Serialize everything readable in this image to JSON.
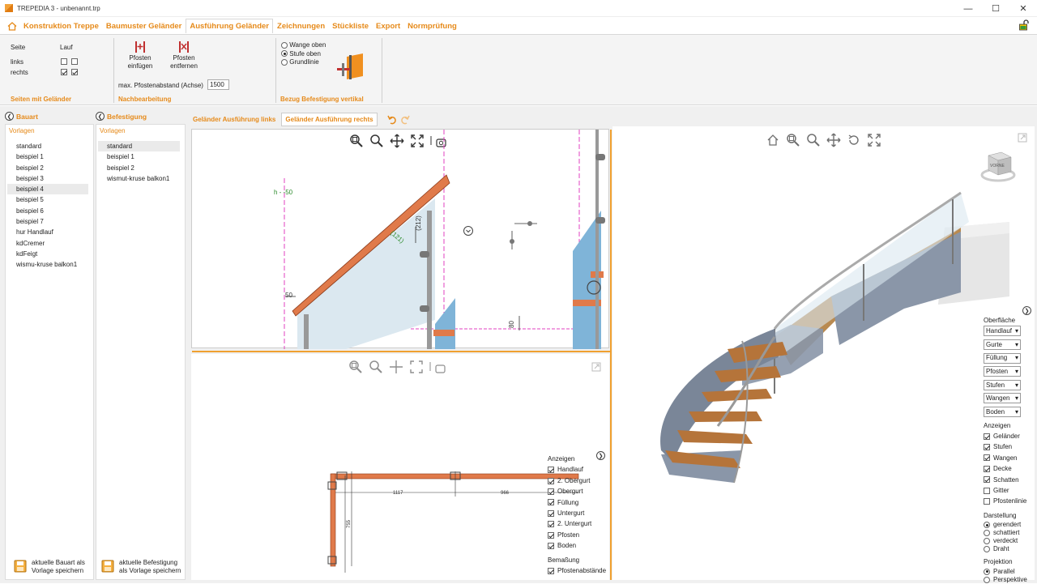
{
  "window": {
    "title": "TREPEDIA 3 - unbenannt.trp"
  },
  "menu": {
    "items": [
      {
        "label": "Konstruktion Treppe"
      },
      {
        "label": "Baumuster Geländer"
      },
      {
        "label": "Ausführung Geländer"
      },
      {
        "label": "Zeichnungen"
      },
      {
        "label": "Stückliste"
      },
      {
        "label": "Export"
      },
      {
        "label": "Normprüfung"
      }
    ],
    "active_index": 2
  },
  "ribbon": {
    "seiten": {
      "col_seite": "Seite",
      "col_lauf": "Lauf",
      "row_links": "links",
      "row_rechts": "rechts",
      "links_checked": [
        false,
        false
      ],
      "rechts_checked": [
        true,
        true
      ],
      "title": "Seiten mit Geländer"
    },
    "nachbearbeitung": {
      "pfosten_einfuegen_1": "Pfosten",
      "pfosten_einfuegen_2": "einfügen",
      "pfosten_entfernen_1": "Pfosten",
      "pfosten_entfernen_2": "entfernen",
      "abstand_label": "max. Pfostenabstand (Achse)",
      "abstand_value": "1500",
      "title": "Nachbearbeitung"
    },
    "bezug": {
      "options": [
        "Wange oben",
        "Stufe oben",
        "Grundlinie"
      ],
      "selected": 1,
      "title": "Bezug Befestigung vertikal"
    }
  },
  "bauart": {
    "header": "Bauart",
    "vorlagen": "Vorlagen",
    "items": [
      "standard",
      "beispiel 1",
      "beispiel 2",
      "beispiel 3",
      "beispiel 4",
      "beispiel 5",
      "beispiel 6",
      "beispiel 7",
      "hur Handlauf",
      "kdCremer",
      "kdFeigt",
      "wismu-kruse balkon1"
    ],
    "selected": 4,
    "save_1": "aktuelle Bauart als",
    "save_2": "Vorlage speichern"
  },
  "befestigung": {
    "header": "Befestigung",
    "vorlagen": "Vorlagen",
    "items": [
      "standard",
      "beispiel 1",
      "beispiel 2",
      "wismut-kruse balkon1"
    ],
    "selected": 0,
    "save_1": "aktuelle Befestigung",
    "save_2": "als Vorlage speichern"
  },
  "tabs": {
    "items": [
      {
        "label": "Geländer Ausführung links"
      },
      {
        "label": "Geländer Ausführung rechts"
      }
    ],
    "active": 1
  },
  "drawing_top": {
    "label_h": "h - -50",
    "dim_50": "50",
    "dim_212": "(212)",
    "dim_121": "(121)",
    "dim_80": "80"
  },
  "drawing_bottom": {
    "dim_1117": "1117",
    "dim_966": "966",
    "dim_755": "755"
  },
  "anzeigen_2d": {
    "title": "Anzeigen",
    "items": [
      {
        "label": "Handlauf",
        "checked": true
      },
      {
        "label": "2. Obergurt",
        "checked": true
      },
      {
        "label": "Obergurt",
        "checked": true
      },
      {
        "label": "Füllung",
        "checked": true
      },
      {
        "label": "Untergurt",
        "checked": true
      },
      {
        "label": "2. Untergurt",
        "checked": true
      },
      {
        "label": "Pfosten",
        "checked": true
      },
      {
        "label": "Boden",
        "checked": true
      }
    ],
    "bemassung_title": "Bemaßung",
    "bemassung_items": [
      {
        "label": "Pfostenabstände",
        "checked": true
      }
    ]
  },
  "view3d": {
    "cube_label": "VORNE",
    "oberflaeche_title": "Oberfläche",
    "oberflaeche": [
      "Handlauf",
      "Gurte",
      "Füllung",
      "Pfosten",
      "Stufen",
      "Wangen",
      "Boden"
    ],
    "anzeigen_title": "Anzeigen",
    "anzeigen": [
      {
        "label": "Geländer",
        "checked": true
      },
      {
        "label": "Stufen",
        "checked": true
      },
      {
        "label": "Wangen",
        "checked": true
      },
      {
        "label": "Decke",
        "checked": true
      },
      {
        "label": "Schatten",
        "checked": true
      },
      {
        "label": "Gitter",
        "checked": false
      },
      {
        "label": "Pfostenlinie",
        "checked": false
      }
    ],
    "darstellung_title": "Darstellung",
    "darstellung": [
      "gerendert",
      "schattiert",
      "verdeckt",
      "Draht"
    ],
    "darstellung_selected": 0,
    "projektion_title": "Projektion",
    "projektion": [
      "Parallel",
      "Perspektive"
    ],
    "projektion_selected": 0
  },
  "colors": {
    "accent": "#e68a1a",
    "handrail": "#e07a4a",
    "guide_magenta": "#e040c0",
    "glass": "#dbe8f0",
    "tread_wood": "#b5743a",
    "stringer": "#8a96a8"
  }
}
